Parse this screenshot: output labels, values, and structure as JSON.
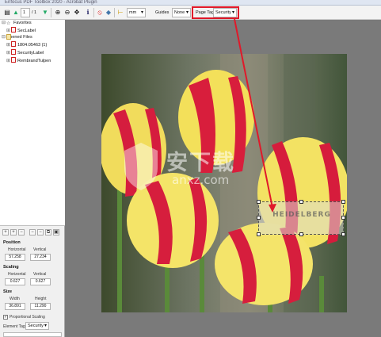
{
  "window": {
    "title": "Enfocus PDF Toolbox 2020 - Acrobat Plugin"
  },
  "toolbar": {
    "page_field": "1",
    "page_of": "/ 1",
    "unit_value": "mm",
    "guides_label": "Guides",
    "guides_value": "None",
    "page_tag_label": "Page Tag",
    "page_tag_value": "Security"
  },
  "tree": {
    "favorites": "Favorites",
    "fav_items": [
      "SecLabel"
    ],
    "opened": "Opened Files",
    "files": [
      "1804.05463 (1)",
      "SecurityLabel",
      "RembrandTulpen"
    ]
  },
  "panel": {
    "position_title": "Position",
    "horizontal_label": "Horizontal",
    "vertical_label": "Vertical",
    "pos_h": "57.258",
    "pos_v": "27.234",
    "scaling_title": "Scaling",
    "scale_h": "0.627",
    "scale_v": "0.627",
    "size_title": "Size",
    "width_label": "Width",
    "height_label": "Height",
    "size_w": "36.891",
    "size_h": "11.290",
    "proportional_label": "Proportional Scaling",
    "element_tag_label": "Element Tag",
    "element_tag_value": "Security"
  },
  "canvas": {
    "watermark_text": "HEIDELBERG",
    "overlay_big": "安下载",
    "overlay_small": "anxz.com"
  },
  "colors": {
    "accent_highlight": "#e0192a",
    "canvas_bg": "#7a7a7a",
    "panel_bg": "#f0f0f0"
  },
  "icons": [
    "doc-icon",
    "up-icon",
    "down-icon",
    "zoom-in-icon",
    "zoom-out-icon",
    "pan-icon",
    "info-icon",
    "no-entry-icon",
    "color-icon",
    "ruler-icon"
  ]
}
